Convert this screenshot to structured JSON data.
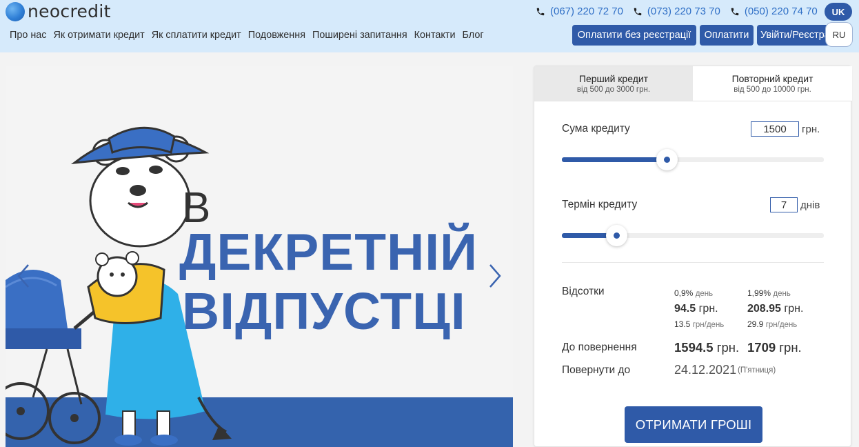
{
  "header": {
    "logo": "neocredit",
    "nav": [
      {
        "label": "Про нас",
        "name": "nav-about"
      },
      {
        "label": "Як отримати кредит",
        "name": "nav-how-to-get"
      },
      {
        "label": "Як сплатити кредит",
        "name": "nav-how-to-pay"
      },
      {
        "label": "Подовження",
        "name": "nav-extension"
      },
      {
        "label": "Поширені запитання",
        "name": "nav-faq"
      },
      {
        "label": "Контакти",
        "name": "nav-contacts"
      },
      {
        "label": "Блог",
        "name": "nav-blog"
      }
    ],
    "phones": [
      "(067) 220 72 70",
      "(073) 220 73 70",
      "(050) 220 74 70"
    ],
    "lang_active": "UK",
    "lang_alt": "RU",
    "buttons": {
      "pay_no_reg": "Оплатити без реєстрації",
      "pay": "Оплатити",
      "login": "Увійти/Реєстрація"
    }
  },
  "banner": {
    "line_small": "В",
    "line_1": "ДЕКРЕТНІЙ",
    "line_2": "ВІДПУСТЦІ",
    "prev_icon": "chevron-left-icon",
    "next_icon": "chevron-right-icon"
  },
  "calculator": {
    "tabs": [
      {
        "title": "Перший кредит",
        "subtitle": "від 500 до 3000 грн."
      },
      {
        "title": "Повторний кредит",
        "subtitle": "від 500 до 10000 грн."
      }
    ],
    "amount": {
      "label": "Сума кредиту",
      "value": "1500",
      "unit": "грн.",
      "fraction": 0.4
    },
    "term": {
      "label": "Термін кредиту",
      "value": "7",
      "unit": "днів",
      "fraction": 0.21
    },
    "interest": {
      "label": "Відсотки",
      "first": {
        "rate": "0,9%",
        "rate_unit": "день",
        "total": "94.5",
        "total_unit": "грн.",
        "daily": "13.5",
        "daily_unit": "грн/день"
      },
      "repeat": {
        "rate": "1,99%",
        "rate_unit": "день",
        "total": "208.95",
        "total_unit": "грн.",
        "daily": "29.9",
        "daily_unit": "грн/день"
      }
    },
    "repay": {
      "label": "До повернення",
      "first": "1594.5",
      "first_unit": "грн.",
      "repeat": "1709",
      "repeat_unit": "грн."
    },
    "due": {
      "label": "Повернути до",
      "date": "24.12.2021",
      "weekday": "(П'ятниця)"
    },
    "cta": "ОТРИМАТИ ГРОШІ"
  },
  "colors": {
    "brand": "#2f5aa8",
    "header_bg": "#d6eafb",
    "banner_blue": "#3a64b0"
  }
}
